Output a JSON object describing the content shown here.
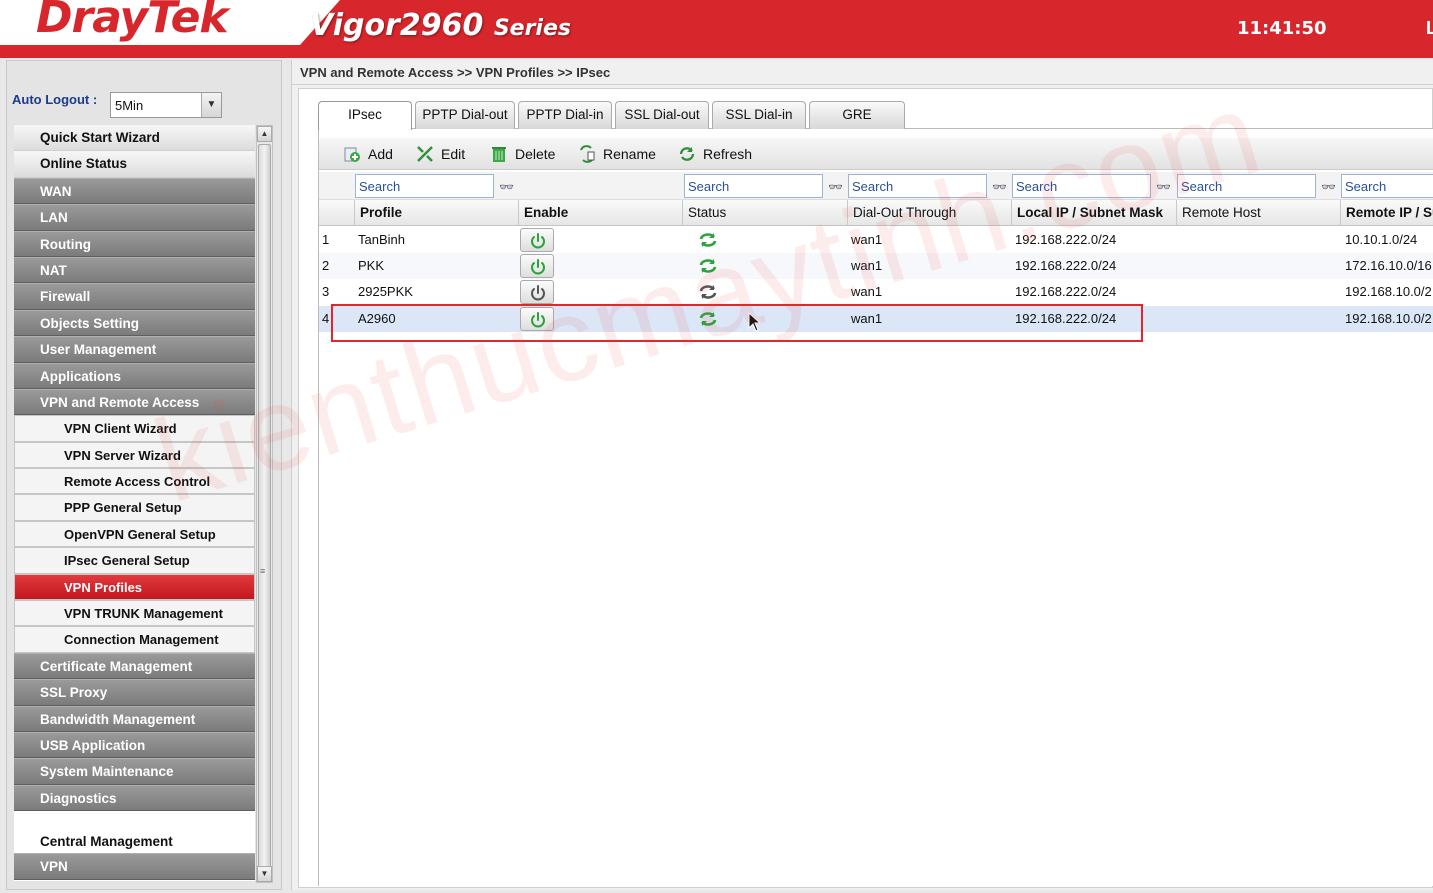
{
  "header": {
    "logo": "DrayTek",
    "model": "Vigor2960",
    "series": "Series",
    "clock": "11:41:50",
    "clock_extra": "L"
  },
  "sidebar": {
    "auto_logout_label": "Auto Logout :",
    "auto_logout_value": "5Min",
    "items": [
      {
        "label": "Quick Start Wizard",
        "style": "light"
      },
      {
        "label": "Online Status",
        "style": "light"
      },
      {
        "label": "WAN",
        "style": "dark"
      },
      {
        "label": "LAN",
        "style": "dark"
      },
      {
        "label": "Routing",
        "style": "dark"
      },
      {
        "label": "NAT",
        "style": "dark"
      },
      {
        "label": "Firewall",
        "style": "dark"
      },
      {
        "label": "Objects Setting",
        "style": "dark"
      },
      {
        "label": "User Management",
        "style": "dark"
      },
      {
        "label": "Applications",
        "style": "dark"
      },
      {
        "label": "VPN and Remote Access",
        "style": "dark"
      },
      {
        "label": "VPN Client Wizard",
        "style": "sub"
      },
      {
        "label": "VPN Server Wizard",
        "style": "sub"
      },
      {
        "label": "Remote Access Control",
        "style": "sub"
      },
      {
        "label": "PPP General Setup",
        "style": "sub"
      },
      {
        "label": "OpenVPN General Setup",
        "style": "sub"
      },
      {
        "label": "IPsec General Setup",
        "style": "sub"
      },
      {
        "label": "VPN Profiles",
        "style": "active"
      },
      {
        "label": "VPN TRUNK Management",
        "style": "sub"
      },
      {
        "label": "Connection Management",
        "style": "sub"
      },
      {
        "label": "Certificate Management",
        "style": "dark"
      },
      {
        "label": "SSL Proxy",
        "style": "dark"
      },
      {
        "label": "Bandwidth Management",
        "style": "dark"
      },
      {
        "label": "USB Application",
        "style": "dark"
      },
      {
        "label": "System Maintenance",
        "style": "dark"
      },
      {
        "label": "Diagnostics",
        "style": "dark"
      }
    ],
    "central_management": "Central Management",
    "vpn": "VPN"
  },
  "breadcrumb": "VPN and Remote Access >> VPN Profiles >> IPsec",
  "tabs": [
    "IPsec",
    "PPTP Dial-out",
    "PPTP Dial-in",
    "SSL Dial-out",
    "SSL Dial-in",
    "GRE"
  ],
  "toolbar": {
    "add": "Add",
    "edit": "Edit",
    "delete": "Delete",
    "rename": "Rename",
    "refresh": "Refresh"
  },
  "search_placeholder": "Search",
  "columns": [
    "Profile",
    "Enable",
    "Status",
    "Dial-Out Through",
    "Local IP / Subnet Mask",
    "Remote Host",
    "Remote IP / Su"
  ],
  "rows": [
    {
      "num": "1",
      "profile": "TanBinh",
      "enabled": true,
      "connected": true,
      "dialout": "wan1",
      "local": "192.168.222.0/24",
      "remote_host": "",
      "remote_ip": "10.10.1.0/24"
    },
    {
      "num": "2",
      "profile": "PKK",
      "enabled": true,
      "connected": true,
      "dialout": "wan1",
      "local": "192.168.222.0/24",
      "remote_host": "",
      "remote_ip": "172.16.10.0/16"
    },
    {
      "num": "3",
      "profile": "2925PKK",
      "enabled": false,
      "connected": false,
      "dialout": "wan1",
      "local": "192.168.222.0/24",
      "remote_host": "",
      "remote_ip": "192.168.10.0/2"
    },
    {
      "num": "4",
      "profile": "A2960",
      "enabled": true,
      "connected": true,
      "dialout": "wan1",
      "local": "192.168.222.0/24",
      "remote_host": "",
      "remote_ip": "192.168.10.0/2"
    }
  ],
  "watermark": "kienthucmaytinh.com",
  "colors": {
    "brand": "#d7262c",
    "enabled": "#2aa33a",
    "disabled": "#555555",
    "selected_row": "#dbe7f7"
  }
}
